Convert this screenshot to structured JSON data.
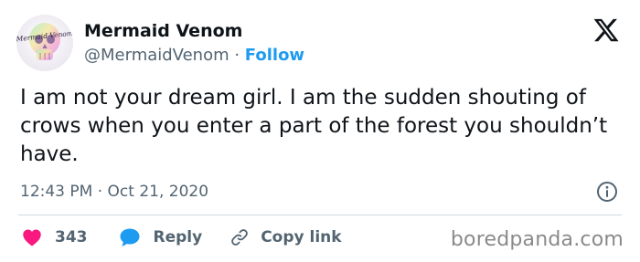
{
  "author": {
    "display_name": "Mermaid Venom",
    "handle": "@MermaidVenom",
    "separator": " · ",
    "follow_label": "Follow",
    "avatar_text": "Mermaid Venom"
  },
  "header": {
    "platform_icon": "x-logo-icon"
  },
  "tweet": {
    "text": "I am not your dream girl. I am the sudden shouting of crows when you enter a part of the forest you shouldn’t have.",
    "timestamp": "12:43 PM · Oct 21, 2020"
  },
  "actions": {
    "like_count": "343",
    "reply_label": "Reply",
    "copy_label": "Copy link"
  },
  "colors": {
    "accent": "#1d9bf0",
    "like": "#f91880",
    "text": "#0f1419",
    "muted": "#536471"
  },
  "watermark": "boredpanda.com"
}
